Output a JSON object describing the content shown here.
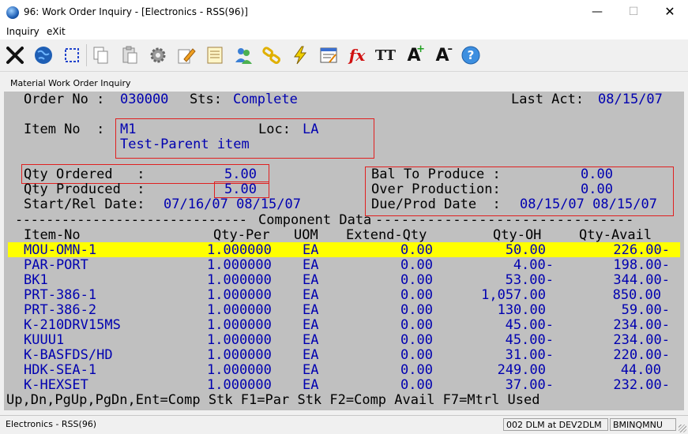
{
  "window": {
    "title": "96: Work Order Inquiry - [Electronics - RSS(96)]",
    "min": "—",
    "max": "☐",
    "close": "✕"
  },
  "menu": [
    {
      "label": "Inquiry"
    },
    {
      "label": "eXit"
    }
  ],
  "toolbar": {
    "icons": [
      "close-icon",
      "globe-icon",
      "select-box-icon",
      "copy-icon",
      "paste-icon",
      "settings-icon",
      "edit-icon",
      "notes-icon",
      "users-icon",
      "link-icon",
      "lightning-icon",
      "form-icon",
      "function-icon",
      "text-format-icon",
      "font-increase-icon",
      "font-decrease-icon",
      "help-icon"
    ],
    "fx": "fx",
    "tt": "TT",
    "a_plus": "A",
    "a_minus": "A",
    "help": "?"
  },
  "panel": {
    "title": "Material Work Order Inquiry"
  },
  "header": {
    "order_label": "Order No :",
    "order_no": "030000",
    "sts_label": "Sts:",
    "sts": "Complete",
    "last_act_label": "Last Act:",
    "last_act": "08/15/07",
    "item_label": "Item No  :",
    "item_no": "M1",
    "loc_label": "Loc:",
    "loc": "LA",
    "item_desc": "Test-Parent item",
    "qty_ordered_label": "Qty Ordered   :",
    "qty_ordered": "5.00",
    "qty_produced_label": "Qty Produced  :",
    "qty_produced": "5.00",
    "start_label": "Start/Rel Date:",
    "start_dates": "07/16/07 08/15/07",
    "bal_label": "Bal To Produce :",
    "bal": "0.00",
    "over_label": "Over Production:",
    "over": "0.00",
    "due_label": "Due/Prod Date  :",
    "due_dates": "08/15/07 08/15/07"
  },
  "components": {
    "divider_left": "------------------------------",
    "divider_title": "Component Data",
    "divider_right": "------------------------------",
    "columns": {
      "item": "Item-No",
      "qty_per": "Qty-Per",
      "uom": "UOM",
      "extend": "Extend-Qty",
      "oh": "Qty-OH",
      "avail": "Qty-Avail"
    },
    "rows": [
      {
        "item": "MOU-OMN-1",
        "qty_per": "1.000000",
        "uom": "EA",
        "extend": "0.00",
        "oh": "50.00",
        "avail": "226.00-"
      },
      {
        "item": "PAR-PORT",
        "qty_per": "1.000000",
        "uom": "EA",
        "extend": "0.00",
        "oh": "4.00-",
        "avail": "198.00-"
      },
      {
        "item": "BK1",
        "qty_per": "1.000000",
        "uom": "EA",
        "extend": "0.00",
        "oh": "53.00-",
        "avail": "344.00-"
      },
      {
        "item": "PRT-386-1",
        "qty_per": "1.000000",
        "uom": "EA",
        "extend": "0.00",
        "oh": "1,057.00",
        "avail": "850.00"
      },
      {
        "item": "PRT-386-2",
        "qty_per": "1.000000",
        "uom": "EA",
        "extend": "0.00",
        "oh": "130.00",
        "avail": "59.00-"
      },
      {
        "item": "K-210DRV15MS",
        "qty_per": "1.000000",
        "uom": "EA",
        "extend": "0.00",
        "oh": "45.00-",
        "avail": "234.00-"
      },
      {
        "item": "KUUU1",
        "qty_per": "1.000000",
        "uom": "EA",
        "extend": "0.00",
        "oh": "45.00-",
        "avail": "234.00-"
      },
      {
        "item": "K-BASFDS/HD",
        "qty_per": "1.000000",
        "uom": "EA",
        "extend": "0.00",
        "oh": "31.00-",
        "avail": "220.00-"
      },
      {
        "item": "HDK-SEA-1",
        "qty_per": "1.000000",
        "uom": "EA",
        "extend": "0.00",
        "oh": "249.00",
        "avail": "44.00"
      },
      {
        "item": "K-HEXSET",
        "qty_per": "1.000000",
        "uom": "EA",
        "extend": "0.00",
        "oh": "37.00-",
        "avail": "232.00-"
      }
    ]
  },
  "footer_keys": "Up,Dn,PgUp,PgDn,Ent=Comp Stk F1=Par Stk F2=Comp Avail F7=Mtrl Used",
  "status": {
    "left": "Electronics - RSS(96)",
    "mid": "002 DLM at DEV2DLM",
    "right": "BMINQMNU"
  },
  "colors": {
    "screen_bg": "#c0c0c0",
    "value": "#0000b0",
    "highlight": "#ffff00",
    "box": "#e02020"
  }
}
